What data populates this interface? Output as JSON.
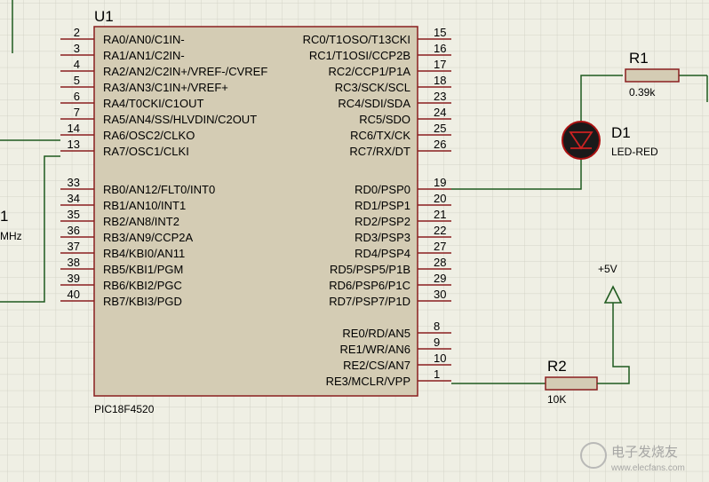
{
  "colors": {
    "background": "#efefe4",
    "grid": "#d3d3c7",
    "chip_fill": "#d4ccb4",
    "chip_border": "#8a1e1e",
    "pin_line": "#8a1e1e",
    "wire": "#1f5a1f",
    "resistor_fill": "#d4ccb4",
    "led_fill": "#1a1a1a",
    "led_outline": "#aa1111",
    "power_symbol": "#1f5a1f"
  },
  "chip": {
    "ref": "U1",
    "part": "PIC18F4520",
    "left_pins": [
      {
        "num": "2",
        "label": "RA0/AN0/C1IN-"
      },
      {
        "num": "3",
        "label": "RA1/AN1/C2IN-"
      },
      {
        "num": "4",
        "label": "RA2/AN2/C2IN+/VREF-/CVREF"
      },
      {
        "num": "5",
        "label": "RA3/AN3/C1IN+/VREF+"
      },
      {
        "num": "6",
        "label": "RA4/T0CKI/C1OUT"
      },
      {
        "num": "7",
        "label": "RA5/AN4/SS/HLVDIN/C2OUT"
      },
      {
        "num": "14",
        "label": "RA6/OSC2/CLKO"
      },
      {
        "num": "13",
        "label": "RA7/OSC1/CLKI"
      },
      {
        "num": "33",
        "label": "RB0/AN12/FLT0/INT0"
      },
      {
        "num": "34",
        "label": "RB1/AN10/INT1"
      },
      {
        "num": "35",
        "label": "RB2/AN8/INT2"
      },
      {
        "num": "36",
        "label": "RB3/AN9/CCP2A"
      },
      {
        "num": "37",
        "label": "RB4/KBI0/AN11"
      },
      {
        "num": "38",
        "label": "RB5/KBI1/PGM"
      },
      {
        "num": "39",
        "label": "RB6/KBI2/PGC"
      },
      {
        "num": "40",
        "label": "RB7/KBI3/PGD"
      }
    ],
    "right_pins": [
      {
        "num": "15",
        "label": "RC0/T1OSO/T13CKI"
      },
      {
        "num": "16",
        "label": "RC1/T1OSI/CCP2B"
      },
      {
        "num": "17",
        "label": "RC2/CCP1/P1A"
      },
      {
        "num": "18",
        "label": "RC3/SCK/SCL"
      },
      {
        "num": "23",
        "label": "RC4/SDI/SDA"
      },
      {
        "num": "24",
        "label": "RC5/SDO"
      },
      {
        "num": "25",
        "label": "RC6/TX/CK"
      },
      {
        "num": "26",
        "label": "RC7/RX/DT"
      },
      {
        "num": "19",
        "label": "RD0/PSP0"
      },
      {
        "num": "20",
        "label": "RD1/PSP1"
      },
      {
        "num": "21",
        "label": "RD2/PSP2"
      },
      {
        "num": "22",
        "label": "RD3/PSP3"
      },
      {
        "num": "27",
        "label": "RD4/PSP4"
      },
      {
        "num": "28",
        "label": "RD5/PSP5/P1B"
      },
      {
        "num": "29",
        "label": "RD6/PSP6/P1C"
      },
      {
        "num": "30",
        "label": "RD7/PSP7/P1D"
      },
      {
        "num": "8",
        "label": "RE0/RD/AN5"
      },
      {
        "num": "9",
        "label": "RE1/WR/AN6"
      },
      {
        "num": "10",
        "label": "RE2/CS/AN7"
      },
      {
        "num": "1",
        "label": "RE3/MCLR/VPP"
      }
    ]
  },
  "r1": {
    "ref": "R1",
    "value": "0.39k"
  },
  "d1": {
    "ref": "D1",
    "value": "LED-RED"
  },
  "r2": {
    "ref": "R2",
    "value": "10K"
  },
  "power": {
    "label": "+5V"
  },
  "crystal": {
    "ref_partial": "1",
    "value_partial": "MHz"
  },
  "watermark": {
    "text": "电子发烧友",
    "sub": "www.elecfans.com"
  }
}
